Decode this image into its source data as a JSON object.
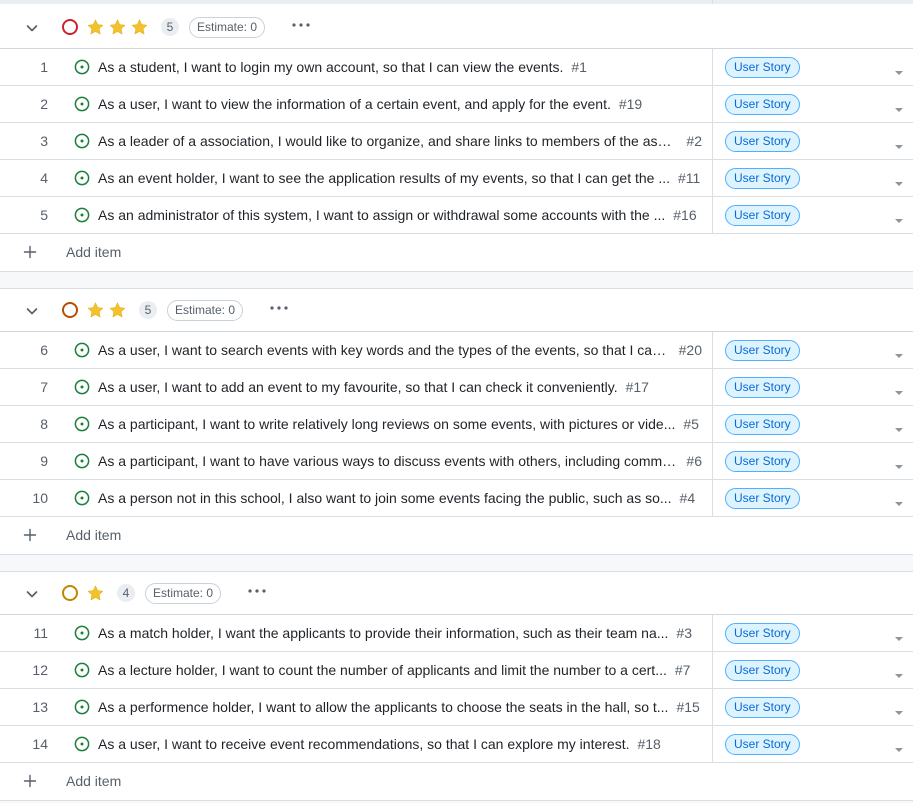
{
  "colors": {
    "urgent_ring": "#cf222e",
    "high_ring": "#bc4c00",
    "medium_ring": "#bf8700",
    "star": "#f2c12e",
    "status_open": "#1a7f37",
    "label_text": "#0969da",
    "label_bg": "#ddf4ff"
  },
  "groups": [
    {
      "ring_icon": "circle-outline-icon",
      "stars": 3,
      "count": "5",
      "estimate": "Estimate: 0",
      "add_label": "Add item",
      "items": [
        {
          "num": "1",
          "title": "As a student, I want to login my own account, so that I can view the events.",
          "ref": "#1",
          "label": "User Story"
        },
        {
          "num": "2",
          "title": "As a user, I want to view the information of a certain event, and apply for the event.",
          "ref": "#19",
          "label": "User Story"
        },
        {
          "num": "3",
          "title": "As a leader of a association, I would like to organize, and share links to members of the asso...",
          "ref": "#2",
          "label": "User Story"
        },
        {
          "num": "4",
          "title": "As an event holder, I want to see the application results of my events, so that I can get the ...",
          "ref": "#11",
          "label": "User Story"
        },
        {
          "num": "5",
          "title": "As an administrator of this system, I want to assign or withdrawal some accounts with the ...",
          "ref": "#16",
          "label": "User Story"
        }
      ]
    },
    {
      "ring_icon": "circle-outline-icon",
      "stars": 2,
      "count": "5",
      "estimate": "Estimate: 0",
      "add_label": "Add item",
      "items": [
        {
          "num": "6",
          "title": "As a user, I want to search events with key words and the types of the events, so that I can ...",
          "ref": "#20",
          "label": "User Story"
        },
        {
          "num": "7",
          "title": "As a user, I want to add an event to my favourite, so that I can check it conveniently.",
          "ref": "#17",
          "label": "User Story"
        },
        {
          "num": "8",
          "title": "As a participant, I want to write relatively long reviews on some events, with pictures or vide...",
          "ref": "#5",
          "label": "User Story"
        },
        {
          "num": "9",
          "title": "As a participant, I want to have various ways to discuss events with others, including comme...",
          "ref": "#6",
          "label": "User Story"
        },
        {
          "num": "10",
          "title": "As a person not in this school, I also want to join some events facing the public, such as so...",
          "ref": "#4",
          "label": "User Story"
        }
      ]
    },
    {
      "ring_icon": "circle-outline-icon",
      "stars": 1,
      "count": "4",
      "estimate": "Estimate: 0",
      "add_label": "Add item",
      "items": [
        {
          "num": "11",
          "title": "As a match holder, I want the applicants to provide their information, such as their team na...",
          "ref": "#3",
          "label": "User Story"
        },
        {
          "num": "12",
          "title": "As a lecture holder, I want to count the number of applicants and limit the number to a cert...",
          "ref": "#7",
          "label": "User Story"
        },
        {
          "num": "13",
          "title": "As a performence holder, I want to allow the applicants to choose the seats in the hall, so t...",
          "ref": "#15",
          "label": "User Story"
        },
        {
          "num": "14",
          "title": "As a user, I want to receive event recommendations, so that I can explore my interest.",
          "ref": "#18",
          "label": "User Story"
        }
      ]
    }
  ]
}
